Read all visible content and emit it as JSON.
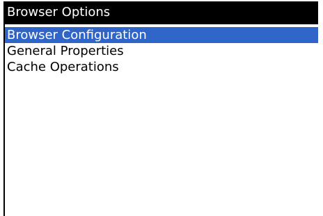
{
  "app": {
    "title": "Browser Options"
  },
  "menu": {
    "items": [
      {
        "label": "Browser Configuration",
        "selected": true
      },
      {
        "label": "General Properties",
        "selected": false
      },
      {
        "label": "Cache Operations",
        "selected": false
      }
    ]
  },
  "colors": {
    "title_background": "#000000",
    "title_text": "#ffffff",
    "selection_background": "#2f64c8",
    "selection_text": "#ffffff",
    "item_text": "#000000",
    "panel_background": "#ffffff"
  }
}
